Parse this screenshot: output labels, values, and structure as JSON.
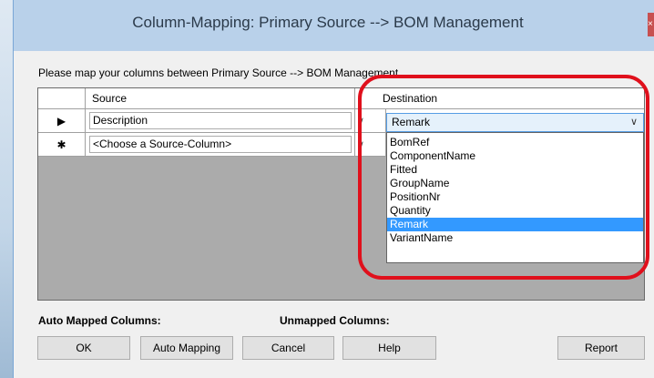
{
  "window": {
    "title": "Column-Mapping: Primary Source  -->  BOM Management",
    "close_label": "×"
  },
  "instruction": "Please map your columns between Primary Source  -->  BOM Management",
  "grid": {
    "columns": [
      "Source",
      "Destination"
    ],
    "rows": [
      {
        "indicator": "▶",
        "source": "Description",
        "destination": "Remark"
      },
      {
        "indicator": "✱",
        "source": "<Choose a Source-Column>",
        "destination": ""
      }
    ],
    "combo_arrow": "∨"
  },
  "dropdown": {
    "options": [
      "BomRef",
      "ComponentName",
      "Fitted",
      "GroupName",
      "PositionNr",
      "Quantity",
      "Remark",
      "VariantName"
    ],
    "selected": "Remark",
    "selected_index": 6
  },
  "summary": {
    "auto_mapped_label": "Auto Mapped Columns:",
    "unmapped_label": "Unmapped Columns:"
  },
  "buttons": {
    "ok": "OK",
    "auto_mapping": "Auto Mapping",
    "cancel": "Cancel",
    "help": "Help",
    "report": "Report"
  },
  "colors": {
    "highlight_ring": "#e0101c",
    "selection": "#3399ff",
    "titlebar": "#b9d1ea"
  }
}
